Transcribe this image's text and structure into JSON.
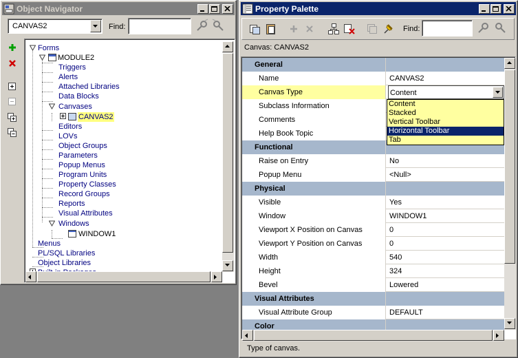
{
  "navigator": {
    "title": "Object Navigator",
    "module_select": "CANVAS2",
    "find_label": "Find:",
    "find_value": "",
    "tree": [
      {
        "label": "Forms"
      },
      {
        "label": "MODULE2"
      },
      {
        "label": "Triggers"
      },
      {
        "label": "Alerts"
      },
      {
        "label": "Attached Libraries"
      },
      {
        "label": "Data Blocks"
      },
      {
        "label": "Canvases"
      },
      {
        "label": "CANVAS2"
      },
      {
        "label": "Editors"
      },
      {
        "label": "LOVs"
      },
      {
        "label": "Object Groups"
      },
      {
        "label": "Parameters"
      },
      {
        "label": "Popup Menus"
      },
      {
        "label": "Program Units"
      },
      {
        "label": "Property Classes"
      },
      {
        "label": "Record Groups"
      },
      {
        "label": "Reports"
      },
      {
        "label": "Visual Attributes"
      },
      {
        "label": "Windows"
      },
      {
        "label": "WINDOW1"
      },
      {
        "label": "Menus"
      },
      {
        "label": "PL/SQL Libraries"
      },
      {
        "label": "Object Libraries"
      },
      {
        "label": "Built-in Packages"
      }
    ]
  },
  "palette": {
    "title": "Property Palette",
    "find_label": "Find:",
    "find_value": "",
    "context": "Canvas: CANVAS2",
    "rows": [
      {
        "name": "General",
        "value": ""
      },
      {
        "name": "Name",
        "value": "CANVAS2"
      },
      {
        "name": "Canvas Type",
        "value": "Content"
      },
      {
        "name": "Subclass Information",
        "value": ""
      },
      {
        "name": "Comments",
        "value": ""
      },
      {
        "name": "Help Book Topic",
        "value": ""
      },
      {
        "name": "Functional",
        "value": ""
      },
      {
        "name": "Raise on Entry",
        "value": "No"
      },
      {
        "name": "Popup Menu",
        "value": "<Null>"
      },
      {
        "name": "Physical",
        "value": ""
      },
      {
        "name": "Visible",
        "value": "Yes"
      },
      {
        "name": "Window",
        "value": "WINDOW1"
      },
      {
        "name": "Viewport X Position on Canvas",
        "value": "0"
      },
      {
        "name": "Viewport Y Position on Canvas",
        "value": "0"
      },
      {
        "name": "Width",
        "value": "540"
      },
      {
        "name": "Height",
        "value": "324"
      },
      {
        "name": "Bevel",
        "value": "Lowered"
      },
      {
        "name": "Visual Attributes",
        "value": ""
      },
      {
        "name": "Visual Attribute Group",
        "value": "DEFAULT"
      },
      {
        "name": "Color",
        "value": ""
      }
    ],
    "dropdown_options": [
      "Content",
      "Stacked",
      "Vertical Toolbar",
      "Horizontal Toolbar",
      "Tab"
    ],
    "status": "Type of canvas."
  },
  "colors": {
    "active_title": "#0a246a",
    "inactive_title": "#808080",
    "section_bg": "#a6b7cc",
    "highlight": "#ffffa0"
  }
}
